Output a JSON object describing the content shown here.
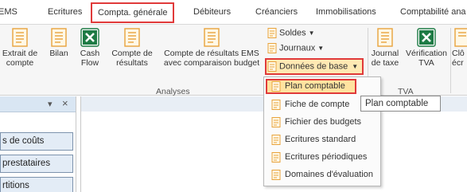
{
  "tabs": [
    {
      "label": "EMS",
      "active": false
    },
    {
      "label": "Ecritures",
      "active": false
    },
    {
      "label": "Compta. générale",
      "active": true
    },
    {
      "label": "Débiteurs",
      "active": false
    },
    {
      "label": "Créanciers",
      "active": false
    },
    {
      "label": "Immobilisations",
      "active": false
    },
    {
      "label": "Comptabilité ana",
      "active": false
    }
  ],
  "ribbon": {
    "analyses": {
      "label": "Analyses",
      "buttons": [
        {
          "line1": "Extrait de",
          "line2": "compte",
          "icon": "report-icon"
        },
        {
          "line1": "Bilan",
          "line2": "",
          "icon": "report-icon"
        },
        {
          "line1": "Cash",
          "line2": "Flow",
          "icon": "excel-icon"
        },
        {
          "line1": "Compte de",
          "line2": "résultats",
          "icon": "report-icon"
        },
        {
          "line1": "Compte de résultats EMS",
          "line2": "avec comparaison budget",
          "icon": "report-icon"
        }
      ]
    },
    "small_buttons": {
      "soldes": "Soldes",
      "journaux": "Journaux",
      "donnees_de_base": "Données de base"
    },
    "tva": {
      "label": "TVA",
      "buttons": [
        {
          "line1": "Journal",
          "line2": "de taxe",
          "icon": "report-icon"
        },
        {
          "line1": "Vérification",
          "line2": "TVA",
          "icon": "excel-icon"
        },
        {
          "line1": "Clô",
          "line2": "écr",
          "icon": "report-icon"
        }
      ]
    }
  },
  "left_panel": {
    "close_glyph": "×",
    "pin_glyph": "▾",
    "items": [
      "s de coûts",
      "prestataires",
      "rtitions"
    ]
  },
  "menu": {
    "items": [
      {
        "label": "Plan comptable",
        "selected": true
      },
      {
        "label": "Fiche de compte",
        "selected": false
      },
      {
        "label": "Fichier des budgets",
        "selected": false
      },
      {
        "label": "Ecritures standard",
        "selected": false
      },
      {
        "label": "Ecritures périodiques",
        "selected": false
      },
      {
        "label": "Domaines d'évaluation",
        "selected": false
      }
    ]
  },
  "tooltip": "Plan comptable",
  "colors": {
    "highlight_border": "#e03a3a",
    "selected_fill": "#ffe3a0",
    "excel_green": "#1e7b45",
    "report_orange": "#e8a33c"
  }
}
